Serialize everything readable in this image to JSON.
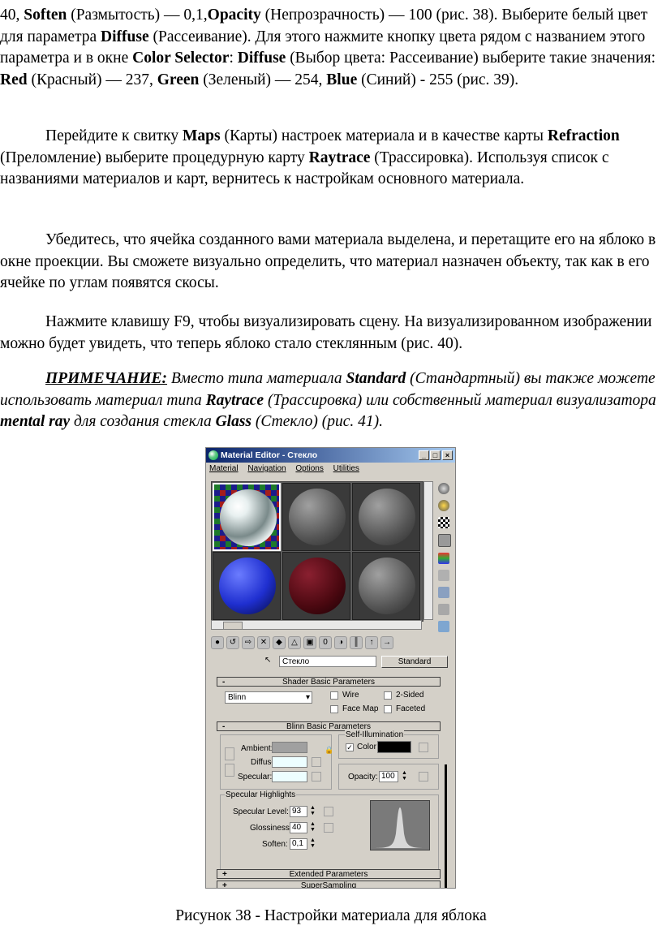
{
  "paragraphs": {
    "p1": {
      "t1": "40, ",
      "b1": "Soften",
      "t2": " (Размытость) — 0,1,",
      "b2": "Opacity",
      "t3": " (Непрозрачность) — 100 (рис. 38). Выберите белый цвет для параметра ",
      "b3": "Diffuse",
      "t4": " (Рассеивание). Для этого нажмите кнопку цвета рядом с названием этого параметра и в окне ",
      "b4": "Color Selector",
      "t5": ": ",
      "b5": "Diffuse",
      "t6": " (Выбор цвета: Рассеивание) выберите такие значения: ",
      "b6": "Red",
      "t7": " (Красный) — 237, ",
      "b7": "Green",
      "t8": " (Зеленый) — 254, ",
      "b8": "Blue",
      "t9": " (Синий) - 255 (рис. 39)."
    },
    "p2": {
      "t1": "Перейдите к свитку ",
      "b1": "Maps",
      "t2": " (Карты) настроек материала и в качестве карты ",
      "b2": "Refraction",
      "t3": " (Преломление) выберите процедурную карту ",
      "b3": "Raytrace",
      "t4": " (Трассировка). Используя список с названиями материалов и карт, вернитесь к настройкам основного материала."
    },
    "p3": "Убедитесь, что ячейка созданного вами материала выделена, и перетащите его на яблоко в окне проекции. Вы сможете визуально определить, что материал назначен объекту, так как в его ячейке по углам появятся скосы.",
    "p4": "Нажмите клавишу F9, чтобы визуализировать сцену. На визуализированном изображении можно будет увидеть, что теперь яблоко стало стеклянным (рис. 40).",
    "note": {
      "label": "ПРИМЕЧАНИЕ:",
      "t1": " Вместо типа материала ",
      "b1": "Standard",
      "t2": " (Стандартный) вы также можете использовать материал типа ",
      "b2": "Raytrace",
      "t3": " (Трассировка) или собственный материал визуализатора ",
      "b3": "mental ray",
      "t4": " для создания стекла ",
      "b4": "Glass",
      "t5": " (Стекло) (рис. 41)."
    }
  },
  "caption": "Рисунок 38 - Настройки материала для яблока",
  "editor": {
    "title": "Material Editor - Стекло",
    "menu": [
      "Material",
      "Navigation",
      "Options",
      "Utilities"
    ],
    "material_name": "Стекло",
    "material_type": "Standard",
    "shader_rollout": "Shader Basic Parameters",
    "shader": "Blinn",
    "checkboxes": {
      "wire": "Wire",
      "two_sided": "2-Sided",
      "face_map": "Face Map",
      "faceted": "Faceted"
    },
    "blinn_rollout": "Blinn Basic Parameters",
    "self_illum": "Self-Illumination",
    "color_label": "Color",
    "ambient": "Ambient:",
    "diffuse": "Diffuse:",
    "specular": "Specular:",
    "opacity_label": "Opacity:",
    "opacity_value": "100",
    "spec_highlights": "Specular Highlights",
    "spec_level_label": "Specular Level:",
    "spec_level_value": "93",
    "glossiness_label": "Glossiness:",
    "glossiness_value": "40",
    "soften_label": "Soften:",
    "soften_value": "0,1",
    "extended_rollout": "Extended Parameters",
    "supersampling_rollout": "SuperSampling"
  },
  "colors": {
    "diffuse": "#EDFEFF",
    "ambient": "#A0A0A0",
    "self_illum": "#000000",
    "title_bar": "#0A246A"
  }
}
